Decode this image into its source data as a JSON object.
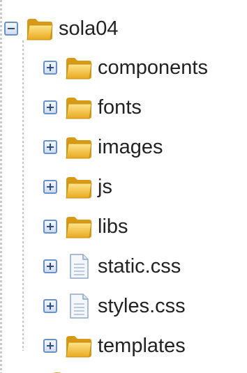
{
  "tree": {
    "root": {
      "label": "sola04",
      "expanded": true,
      "icon": "folder-icon"
    },
    "children": [
      {
        "label": "components",
        "type": "folder",
        "icon": "folder-icon"
      },
      {
        "label": "fonts",
        "type": "folder",
        "icon": "folder-icon"
      },
      {
        "label": "images",
        "type": "folder",
        "icon": "folder-icon"
      },
      {
        "label": "js",
        "type": "folder",
        "icon": "folder-icon"
      },
      {
        "label": "libs",
        "type": "folder",
        "icon": "folder-icon"
      },
      {
        "label": "static.css",
        "type": "file",
        "icon": "file-icon"
      },
      {
        "label": "styles.css",
        "type": "file",
        "icon": "file-icon"
      },
      {
        "label": "templates",
        "type": "folder",
        "icon": "folder-icon"
      }
    ]
  },
  "colors": {
    "folder": "#f2c13a",
    "toggle_border": "#6a90c8",
    "text": "#222222"
  }
}
